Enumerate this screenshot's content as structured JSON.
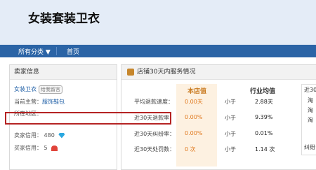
{
  "header": {
    "title": "女装套装卫衣"
  },
  "nav": {
    "items": [
      "所有分类 ▼",
      "首页"
    ]
  },
  "seller": {
    "section_title": "卖家信息",
    "shop_name": "女装卫衣",
    "contact_badge": "给我留言",
    "main_business_label": "当前主营：",
    "main_business_value": "服饰鞋包",
    "location_label": "所在地区：",
    "seller_credit_label": "卖家信用：",
    "seller_credit_value": "480",
    "buyer_credit_label": "买家信用：",
    "buyer_credit_value": "5"
  },
  "service": {
    "title": "店铺30天内服务情况",
    "col_store": "本店值",
    "col_avg": "行业均值",
    "rows": [
      {
        "label": "平均退款速度：",
        "store": "0.00天",
        "cmp": "小于",
        "avg": "2.88天"
      },
      {
        "label": "近30天退款率：",
        "store": "0.00%",
        "cmp": "小于",
        "avg": "9.39%"
      },
      {
        "label": "近30天纠纷率：",
        "store": "0.00%",
        "cmp": "小于",
        "avg": "0.01%"
      },
      {
        "label": "近30天处罚数：",
        "store": "0 次",
        "cmp": "小于",
        "avg": "1.14 次"
      }
    ],
    "side_title": "近30",
    "side_items": [
      "淘",
      "淘",
      "淘"
    ],
    "side_footer": "纠纷"
  },
  "colors": {
    "accent_blue": "#2b64a6",
    "store_orange": "#e07a20",
    "highlight_red": "#b52323"
  }
}
